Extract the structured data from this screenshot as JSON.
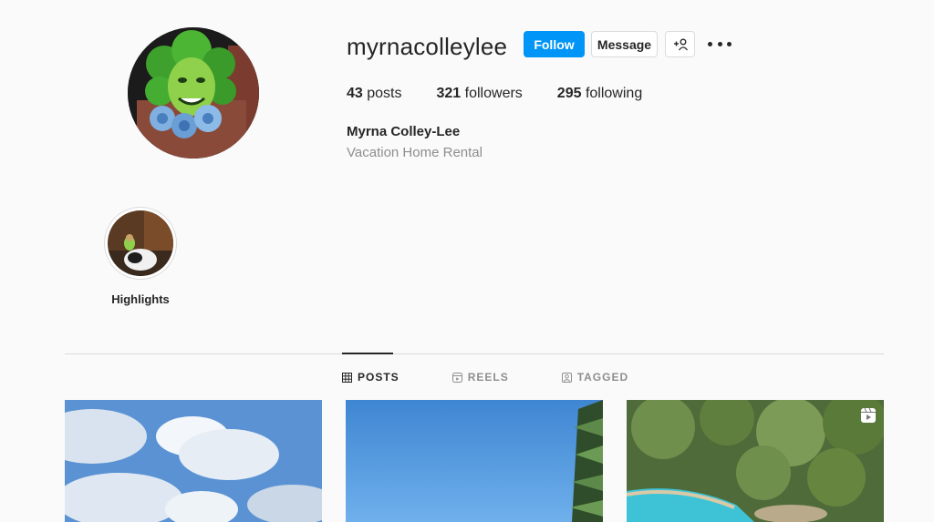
{
  "profile": {
    "username": "myrnacolleylee",
    "full_name": "Myrna Colley-Lee",
    "category": "Vacation Home Rental",
    "avatar_icon": "profile-photo"
  },
  "actions": {
    "follow_label": "Follow",
    "message_label": "Message",
    "add_user_icon": "add-user-icon",
    "more_icon": "more-options-icon"
  },
  "stats": {
    "posts_count": "43",
    "posts_label": "posts",
    "followers_count": "321",
    "followers_label": "followers",
    "following_count": "295",
    "following_label": "following"
  },
  "highlights": [
    {
      "label": "Highlights"
    }
  ],
  "tabs": [
    {
      "label": "POSTS",
      "icon": "grid-icon",
      "active": true
    },
    {
      "label": "REELS",
      "icon": "reels-icon",
      "active": false
    },
    {
      "label": "TAGGED",
      "icon": "tagged-icon",
      "active": false
    }
  ],
  "colors": {
    "accent": "#0095f6",
    "background": "#fafafa",
    "border": "#dbdbdb",
    "muted_text": "#8e8e8e"
  }
}
